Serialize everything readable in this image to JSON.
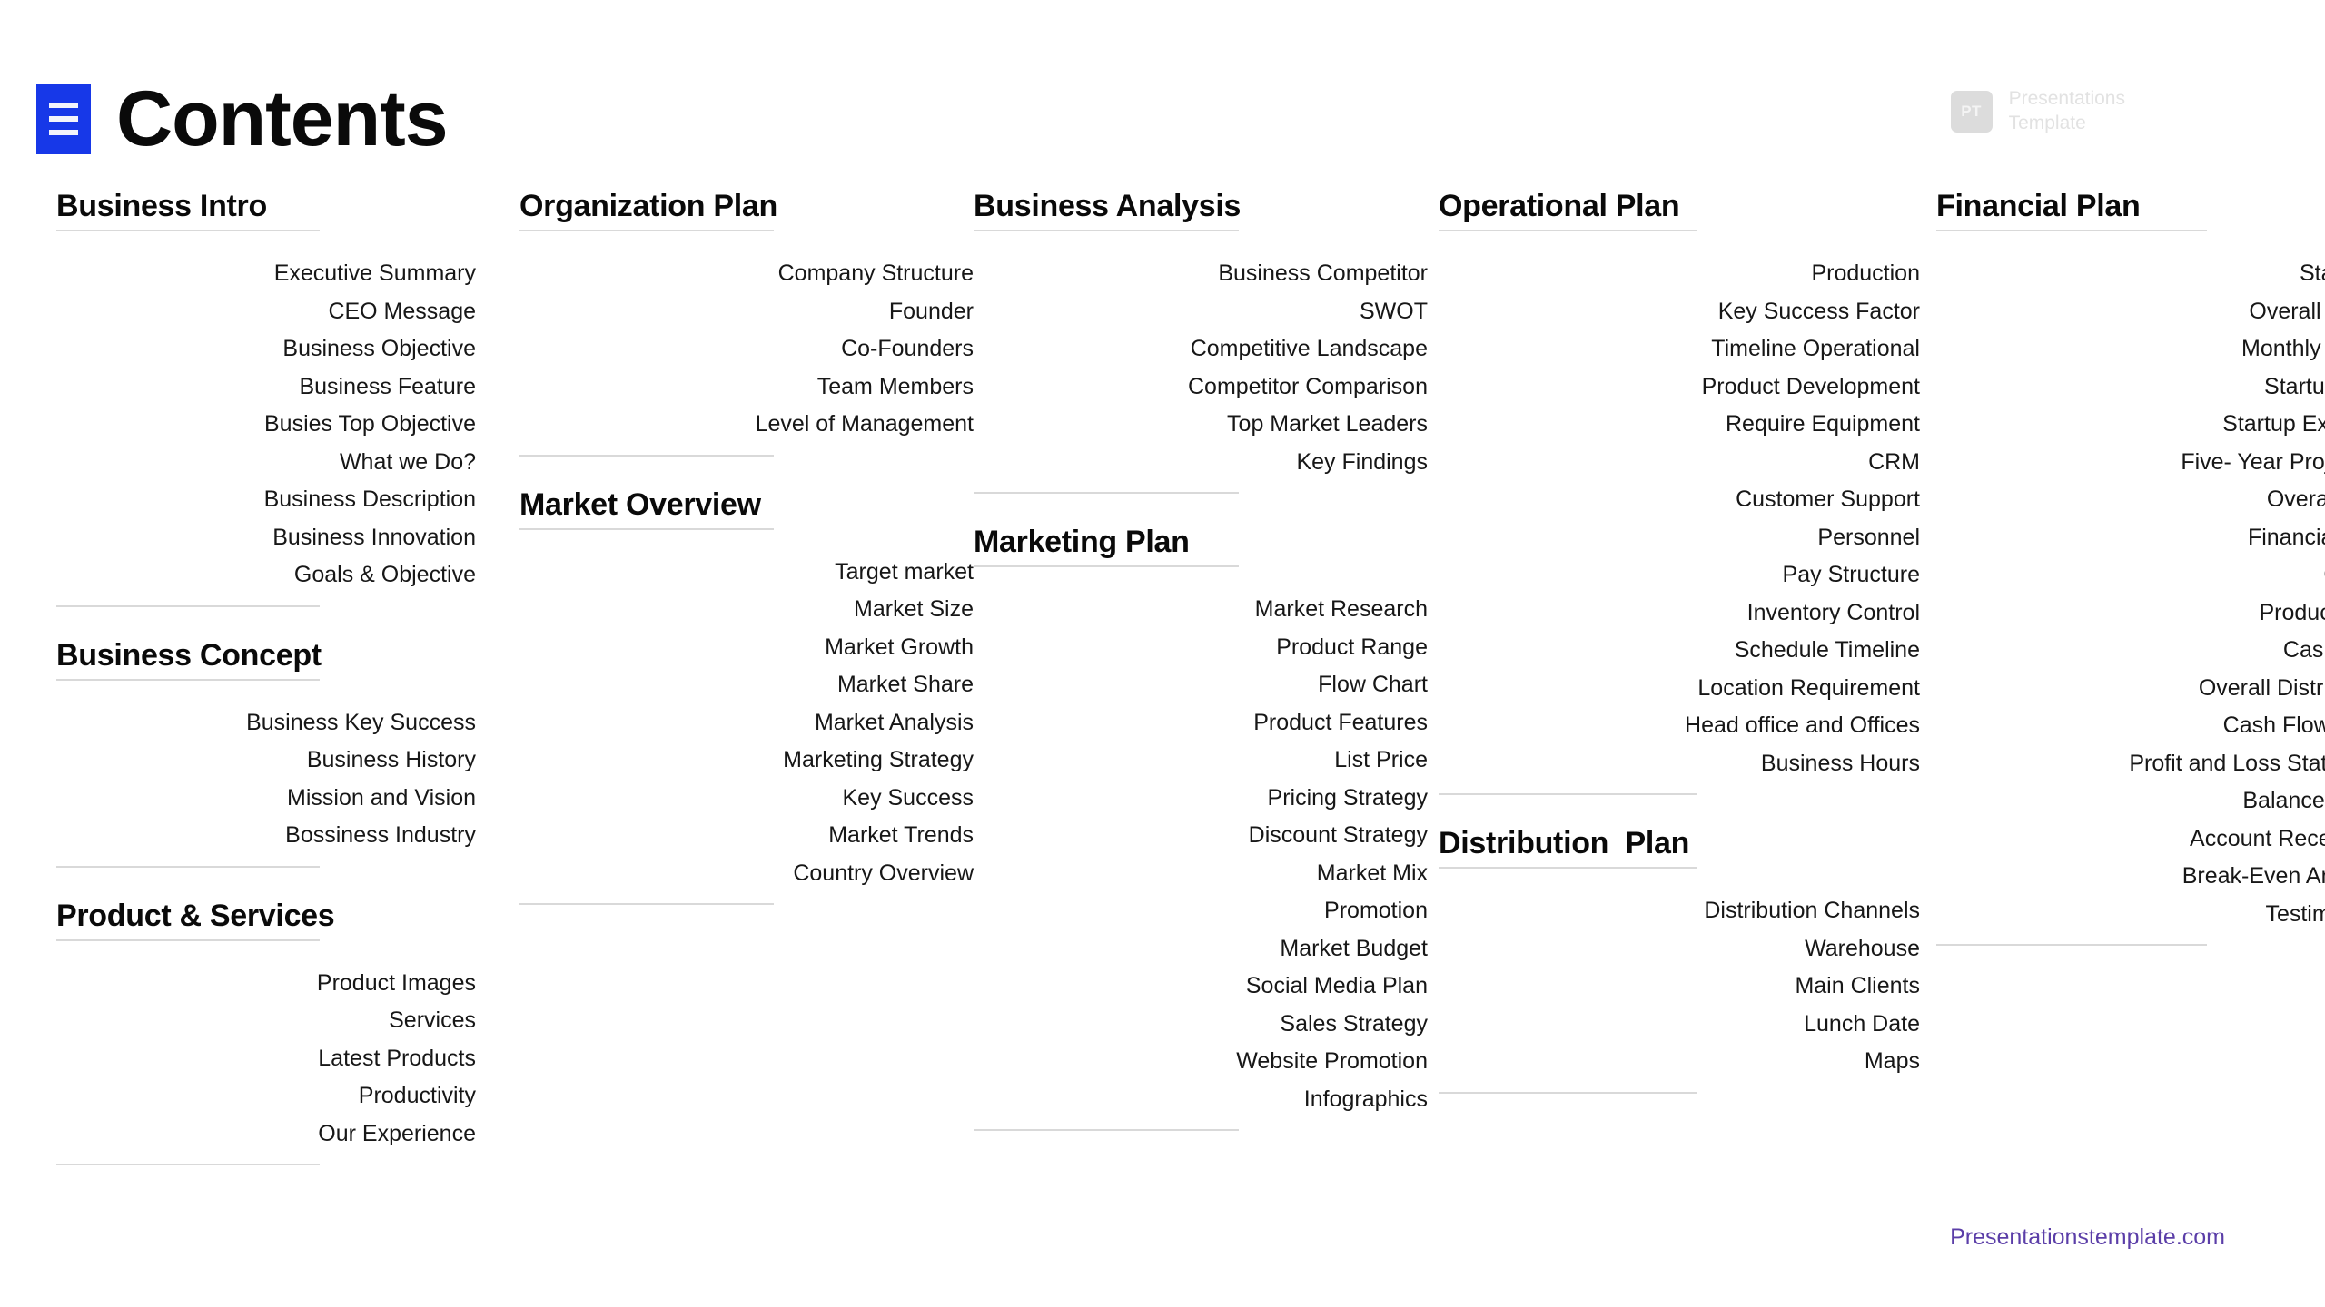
{
  "header": {
    "title": "Contents",
    "menu_icon": "hamburger-menu-icon",
    "menu_color": "#1738E8"
  },
  "brand": {
    "badge_text": "PT",
    "line1": "Presentations",
    "line2": "Template",
    "color": "#E2E2E2"
  },
  "footer": {
    "link_text": "Presentationstemplate.com",
    "color": "#5B3EA8"
  },
  "columns": [
    {
      "name": "column-1",
      "groups": [
        {
          "title": "Business Intro",
          "items": [
            "Executive Summary",
            "CEO Message",
            "Business Objective",
            "Business Feature",
            "Busies Top Objective",
            "What we Do?",
            "Business Description",
            "Business Innovation",
            "Goals & Objective"
          ]
        },
        {
          "title": "Business Concept",
          "items": [
            "Business Key Success",
            "Business History",
            "Mission and Vision",
            "Bossiness Industry"
          ]
        },
        {
          "title": "Product & Services",
          "items": [
            "Product Images",
            "Services",
            "Latest Products",
            "Productivity",
            "Our Experience"
          ]
        }
      ]
    },
    {
      "name": "column-2",
      "groups": [
        {
          "title": "Organization Plan",
          "items": [
            "Company Structure",
            "Founder",
            "Co-Founders",
            "Team Members",
            "Level of Management"
          ]
        },
        {
          "title": "Market Overview",
          "items": [
            "Target market",
            "Market Size",
            "Market Growth",
            "Market Share",
            "Market Analysis",
            "Marketing Strategy",
            "Key Success",
            "Market Trends",
            "Country Overview"
          ]
        }
      ]
    },
    {
      "name": "column-3",
      "groups": [
        {
          "title": "Business Analysis",
          "items": [
            "Business Competitor",
            "SWOT",
            "Competitive Landscape",
            "Competitor Comparison",
            "Top Market Leaders",
            "Key Findings"
          ]
        },
        {
          "title": "Marketing Plan",
          "items": [
            "Market Research",
            "Product Range",
            "Flow Chart",
            "Product Features",
            "List Price",
            "Pricing Strategy",
            "Discount Strategy",
            "Market Mix",
            "Promotion",
            "Market Budget",
            "Social Media Plan",
            "Sales Strategy",
            "Website Promotion",
            "Infographics"
          ]
        }
      ]
    },
    {
      "name": "column-4",
      "groups": [
        {
          "title": "Operational Plan",
          "items": [
            "Production",
            "Key Success Factor",
            "Timeline Operational",
            "Product Development",
            "Require Equipment",
            "CRM",
            "Customer Support",
            "Personnel",
            "Pay Structure",
            "Inventory Control",
            "Schedule Timeline",
            "Location Requirement",
            "Head office and Offices",
            "Business Hours"
          ]
        },
        {
          "title": "Distribution  Plan",
          "items": [
            "Distribution Channels",
            "Warehouse",
            "Main Clients",
            "Lunch Date",
            "Maps"
          ]
        }
      ]
    },
    {
      "name": "column-5",
      "groups": [
        {
          "title": "Financial Plan",
          "items": [
            "Statistics",
            "Overall Funds",
            "Monthly Funds",
            "Startup Cost",
            "Startup Expense",
            "Five- Year Projection",
            "Overall Plan",
            "Financial Year",
            "Charts",
            "Product Cost",
            "Cash Flow",
            "Overall Distribution",
            "Cash Flow Table",
            "Profit and Loss Statement",
            "Balance Sheet",
            "Account Receivable",
            "Break-Even Analysis",
            "Testimonials"
          ]
        }
      ]
    }
  ]
}
